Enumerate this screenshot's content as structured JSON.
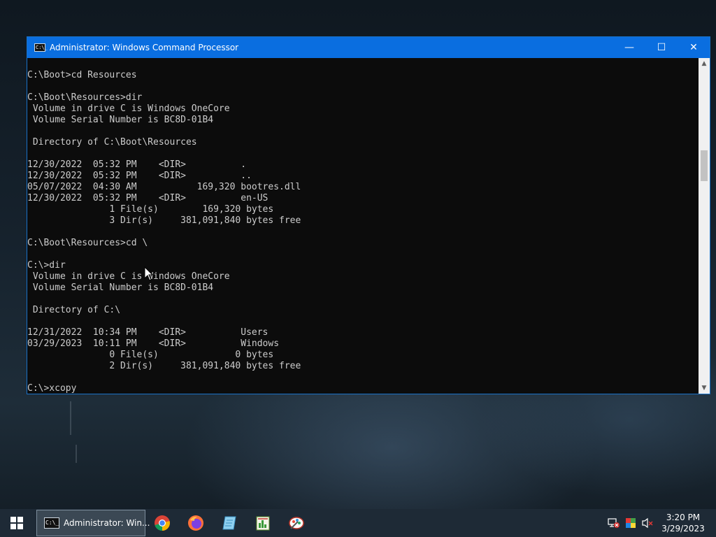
{
  "window": {
    "title": "Administrator: Windows Command Processor",
    "app_icon_text": "C:\\_",
    "controls": {
      "minimize": "—",
      "maximize": "☐",
      "close": "✕"
    }
  },
  "console": {
    "lines": [
      "C:\\Boot>cd Resources",
      "",
      "C:\\Boot\\Resources>dir",
      " Volume in drive C is Windows OneCore",
      " Volume Serial Number is BC8D-01B4",
      "",
      " Directory of C:\\Boot\\Resources",
      "",
      "12/30/2022  05:32 PM    <DIR>          .",
      "12/30/2022  05:32 PM    <DIR>          ..",
      "05/07/2022  04:30 AM           169,320 bootres.dll",
      "12/30/2022  05:32 PM    <DIR>          en-US",
      "               1 File(s)        169,320 bytes",
      "               3 Dir(s)     381,091,840 bytes free",
      "",
      "C:\\Boot\\Resources>cd \\",
      "",
      "C:\\>dir",
      " Volume in drive C is Windows OneCore",
      " Volume Serial Number is BC8D-01B4",
      "",
      " Directory of C:\\",
      "",
      "12/31/2022  10:34 PM    <DIR>          Users",
      "03/29/2023  10:11 PM    <DIR>          Windows",
      "               0 File(s)              0 bytes",
      "               2 Dir(s)     381,091,840 bytes free",
      "",
      "C:\\>xcopy"
    ]
  },
  "scrollbar": {
    "up": "▲",
    "down": "▼"
  },
  "taskbar": {
    "start_icon": "windows-logo-icon",
    "active_task_label": "Administrator: Win...",
    "active_task_icon_text": "C:\\_",
    "pinned": [
      {
        "name": "chrome-icon"
      },
      {
        "name": "firefox-icon"
      },
      {
        "name": "notepad-icon"
      },
      {
        "name": "spreadsheet-icon"
      },
      {
        "name": "paint-icon"
      }
    ],
    "clock": {
      "time": "3:20 PM",
      "date": "3/29/2023"
    }
  },
  "colors": {
    "titlebar": "#0a6ee0",
    "console_bg": "#0c0c0c",
    "console_text": "#cccccc",
    "taskbar": "#1e2a36"
  }
}
